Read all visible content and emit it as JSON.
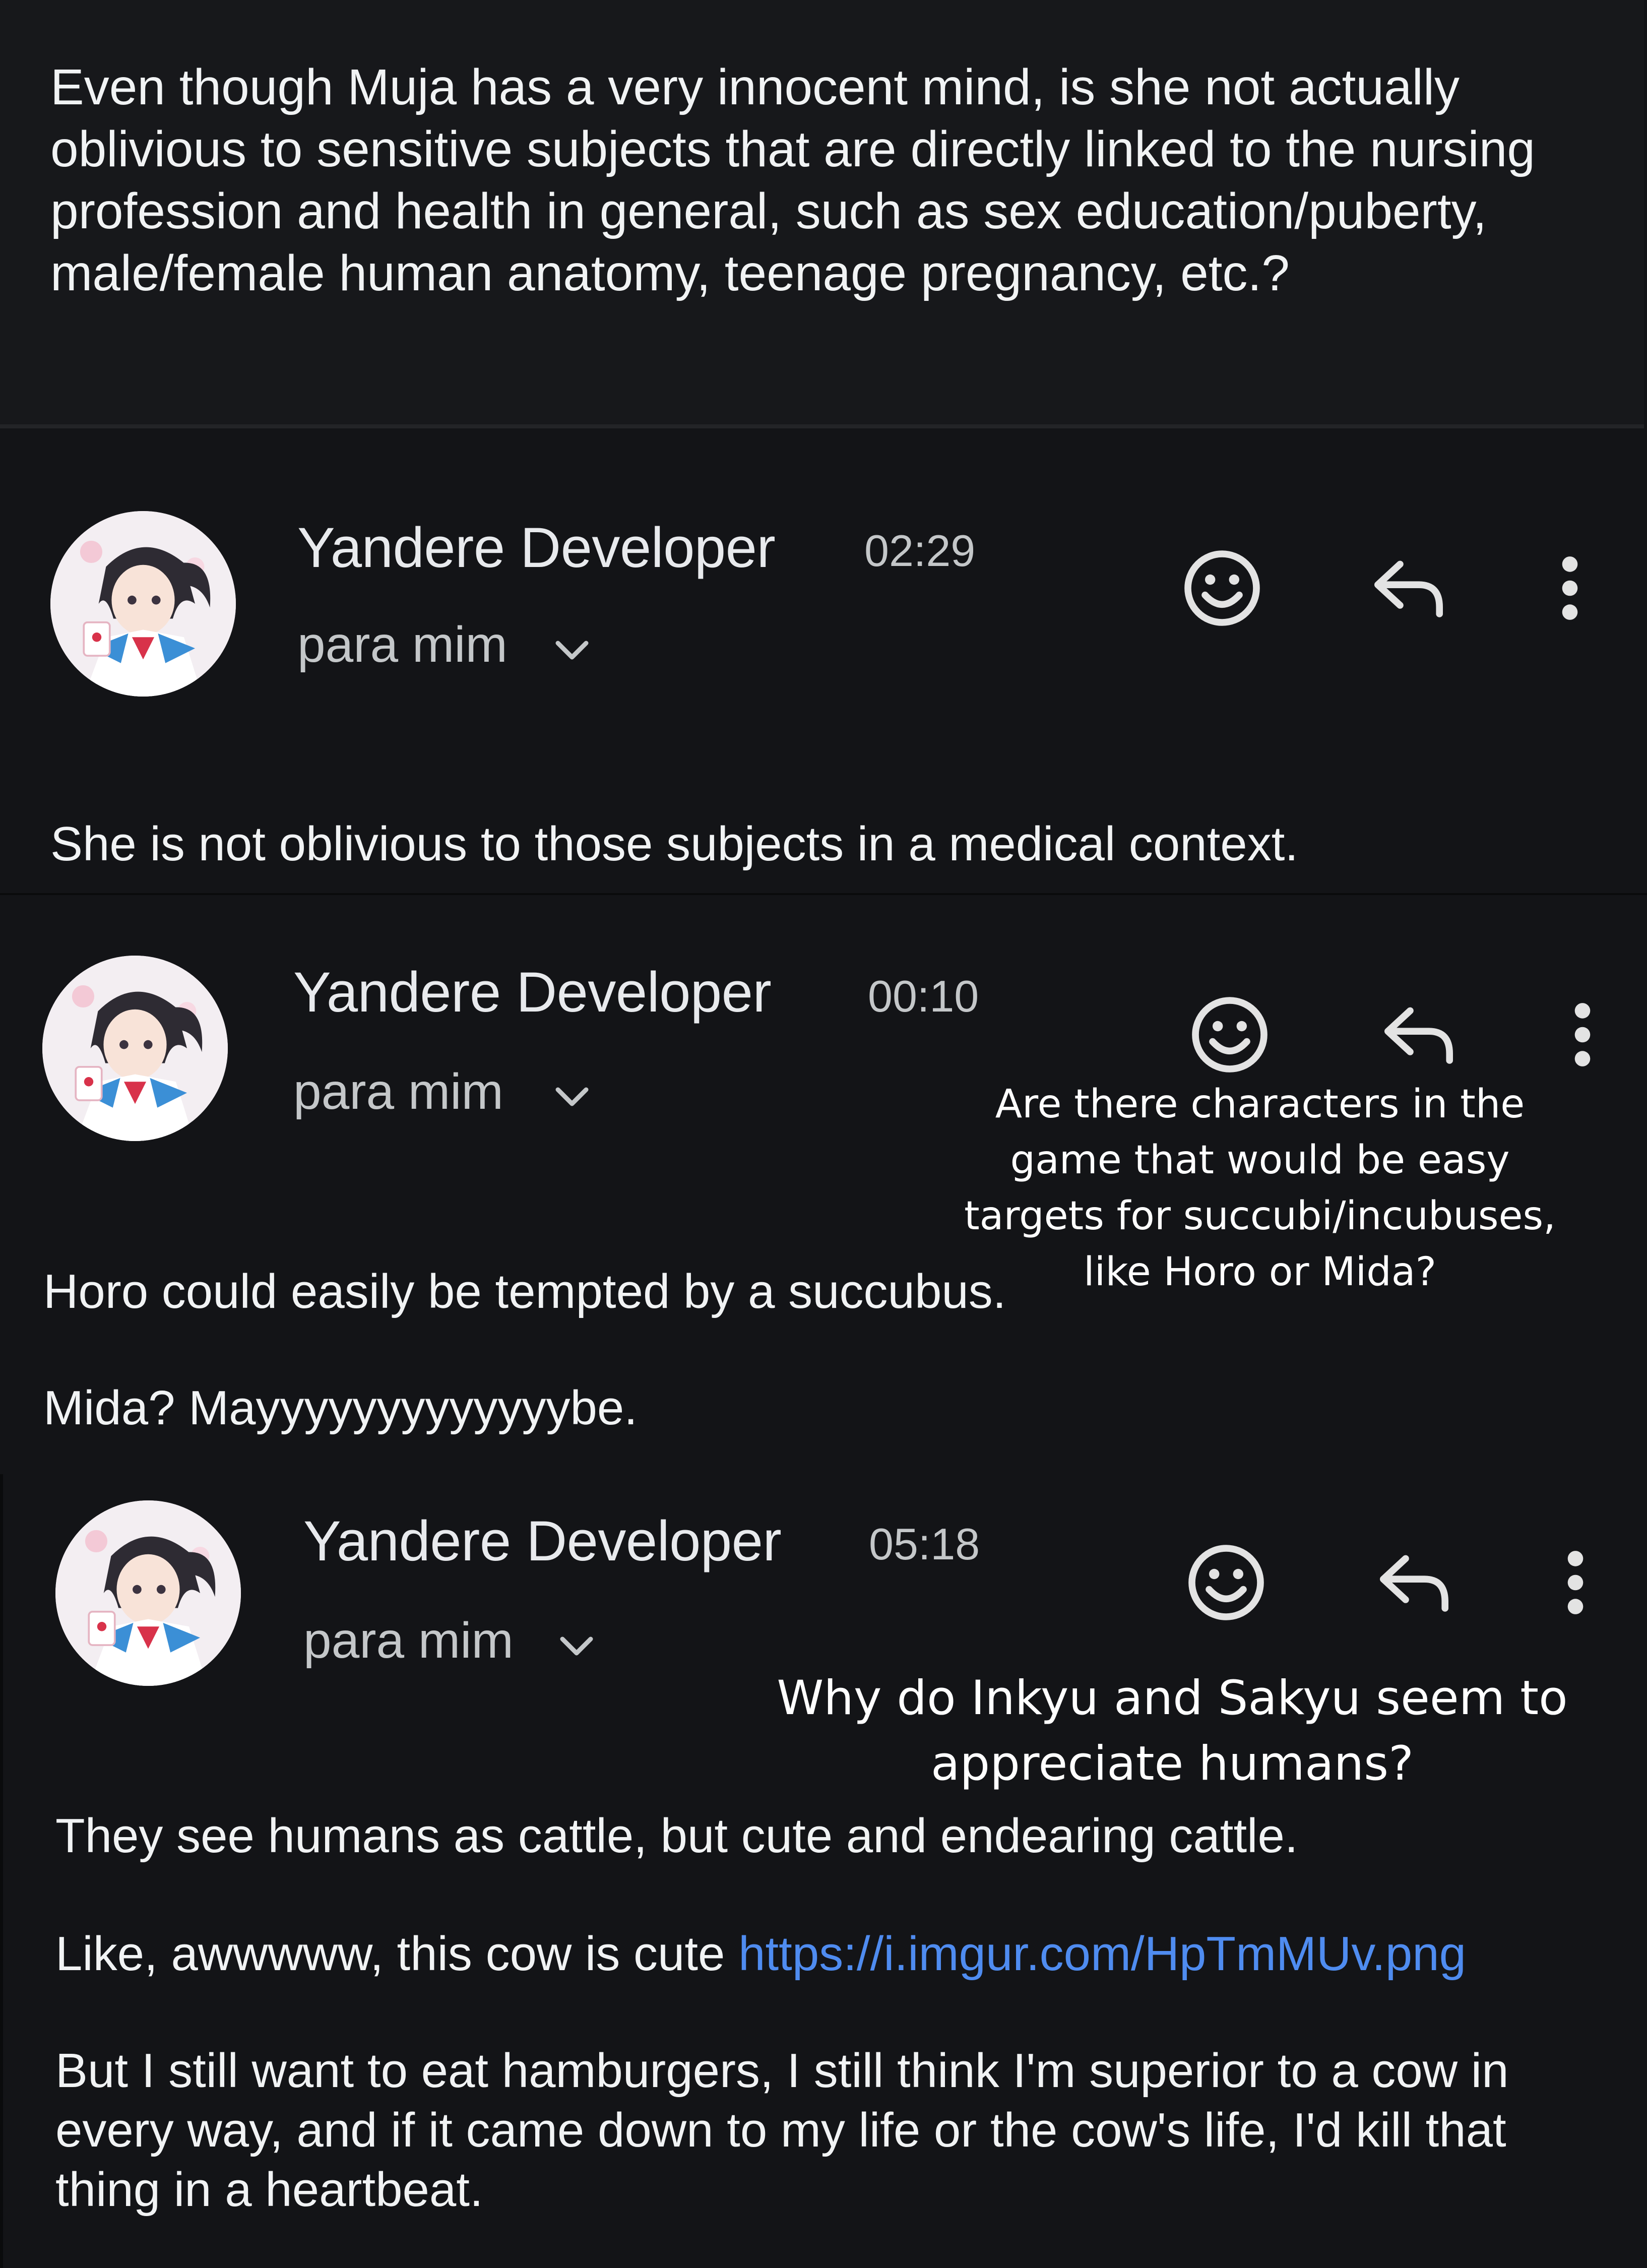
{
  "question_top": "Even though Muja has a very innocent mind, is she not actually oblivious to sensitive subjects that are directly linked to the nursing profession and health in general, such as sex education/puberty, male/female human anatomy, teenage pregnancy, etc.?",
  "messages": [
    {
      "sender": "Yandere Developer",
      "time": "02:29",
      "recipient": "para mim",
      "body": [
        "She is not oblivious to those subjects in a medical context."
      ]
    },
    {
      "sender": "Yandere Developer",
      "time": "00:10",
      "recipient": "para mim",
      "question": "Are there characters in the game that would be easy targets for succubi/incubuses, like Horo or Mida?",
      "body": [
        "Horo could easily be tempted by a succubus.",
        "Mida? Mayyyyyyyyyyyyybe."
      ]
    },
    {
      "sender": "Yandere Developer",
      "time": "05:18",
      "recipient": "para mim",
      "question": "Why do Inkyu and Sakyu seem to appreciate humans?",
      "body": [
        "They see humans as cattle, but cute and endearing cattle.",
        "Like, awwwww, this cow is cute",
        "But I still want to eat hamburgers, I still think I'm superior to a cow in every way, and if it came down to my life or the cow's life, I'd kill that thing in a heartbeat."
      ],
      "link": "https://i.imgur.com/HpTmMUv.png"
    }
  ],
  "icons": [
    "avatar",
    "emoji-reaction-icon",
    "reply-icon",
    "more-options-icon",
    "chevron-down-icon"
  ],
  "colors": {
    "background": "#131417",
    "text": "#f1f3f4",
    "muted": "#c4c7c9",
    "link": "#4f8cf0"
  }
}
